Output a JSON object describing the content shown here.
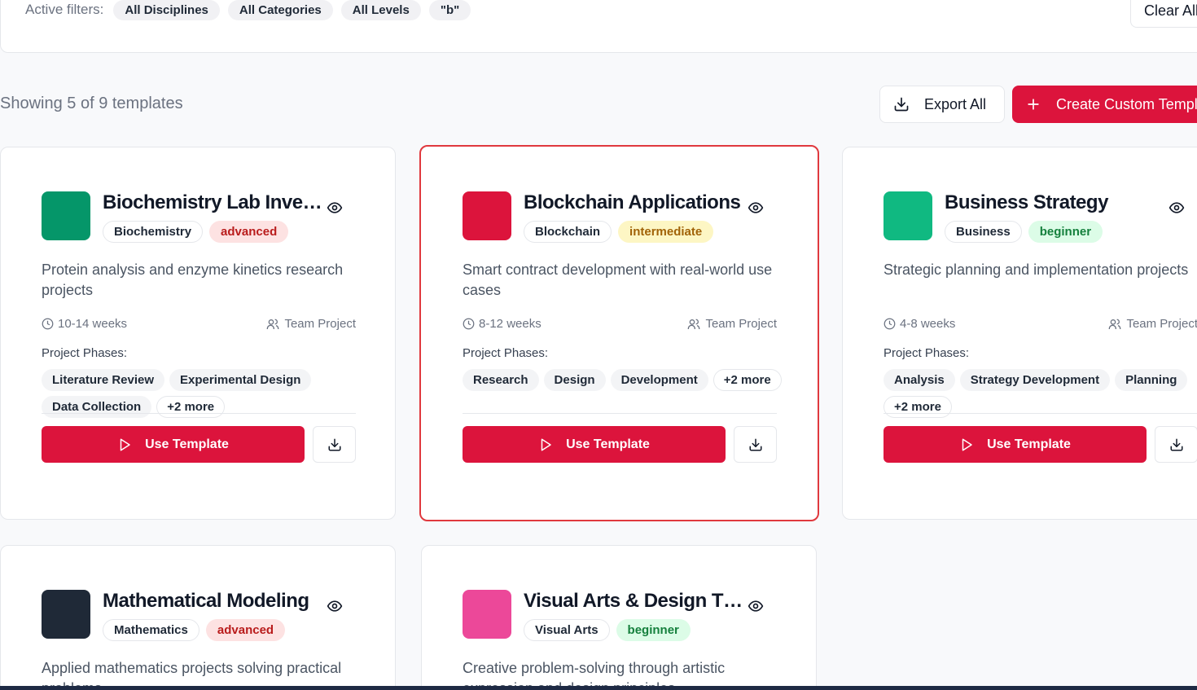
{
  "filters": {
    "label": "Active filters:",
    "chips": [
      "All Disciplines",
      "All Categories",
      "All Levels",
      "\"b\""
    ],
    "clear_label": "Clear All"
  },
  "summary": {
    "showing_text": "Showing 5 of 9 templates",
    "export_label": "Export All",
    "create_label": "Create Custom Template"
  },
  "common": {
    "phases_label": "Project Phases:",
    "use_label": "Use Template"
  },
  "cards": [
    {
      "title": "Biochemistry Lab Investigations",
      "color": "#059669",
      "discipline": "Biochemistry",
      "level": "advanced",
      "description": "Protein analysis and enzyme kinetics research projects",
      "duration": "10-14 weeks",
      "team": "Team Project",
      "phases": [
        "Literature Review",
        "Experimental Design",
        "Data Collection"
      ],
      "more": "+2 more"
    },
    {
      "title": "Blockchain Applications",
      "color": "#dc143c",
      "discipline": "Blockchain",
      "level": "intermediate",
      "description": "Smart contract development with real-world use cases",
      "duration": "8-12 weeks",
      "team": "Team Project",
      "phases": [
        "Research",
        "Design",
        "Development"
      ],
      "more": "+2 more"
    },
    {
      "title": "Business Strategy",
      "color": "#10b981",
      "discipline": "Business",
      "level": "beginner",
      "description": "Strategic planning and implementation projects",
      "duration": "4-8 weeks",
      "team": "Team Project",
      "phases": [
        "Analysis",
        "Strategy Development",
        "Planning"
      ],
      "more": "+2 more"
    },
    {
      "title": "Mathematical Modeling",
      "color": "#1f2937",
      "discipline": "Mathematics",
      "level": "advanced",
      "description": "Applied mathematics projects solving practical problems"
    },
    {
      "title": "Visual Arts & Design Thinking",
      "color": "#ec4899",
      "discipline": "Visual Arts",
      "level": "beginner",
      "description": "Creative problem-solving through artistic expression and design principles"
    }
  ]
}
